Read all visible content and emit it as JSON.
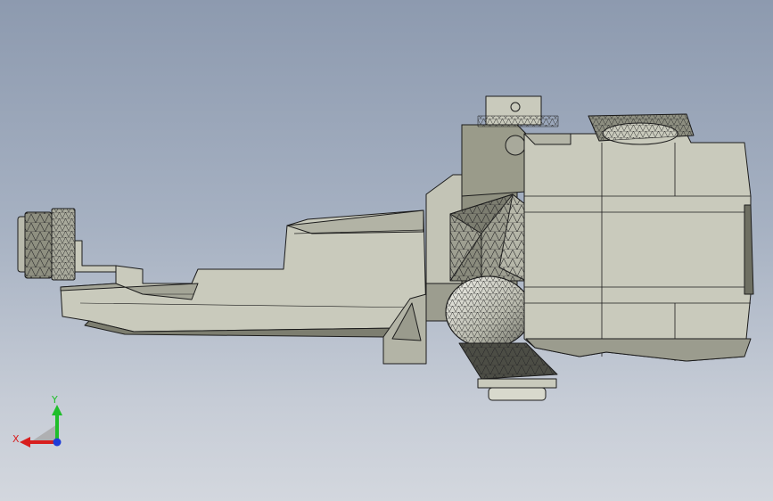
{
  "viewport": {
    "background_top": "#8d9aaf",
    "background_bottom": "#d3d7de"
  },
  "model": {
    "body_color": "#c9cabc",
    "shadow_color": "#8e8f80",
    "dark_color": "#55564d",
    "edge_color": "#1c1c1c"
  },
  "triad": {
    "x_label": "X",
    "y_label": "Y",
    "x_color": "#d81e1e",
    "y_color": "#1fbe2a",
    "z_color": "#1e3cd8"
  }
}
